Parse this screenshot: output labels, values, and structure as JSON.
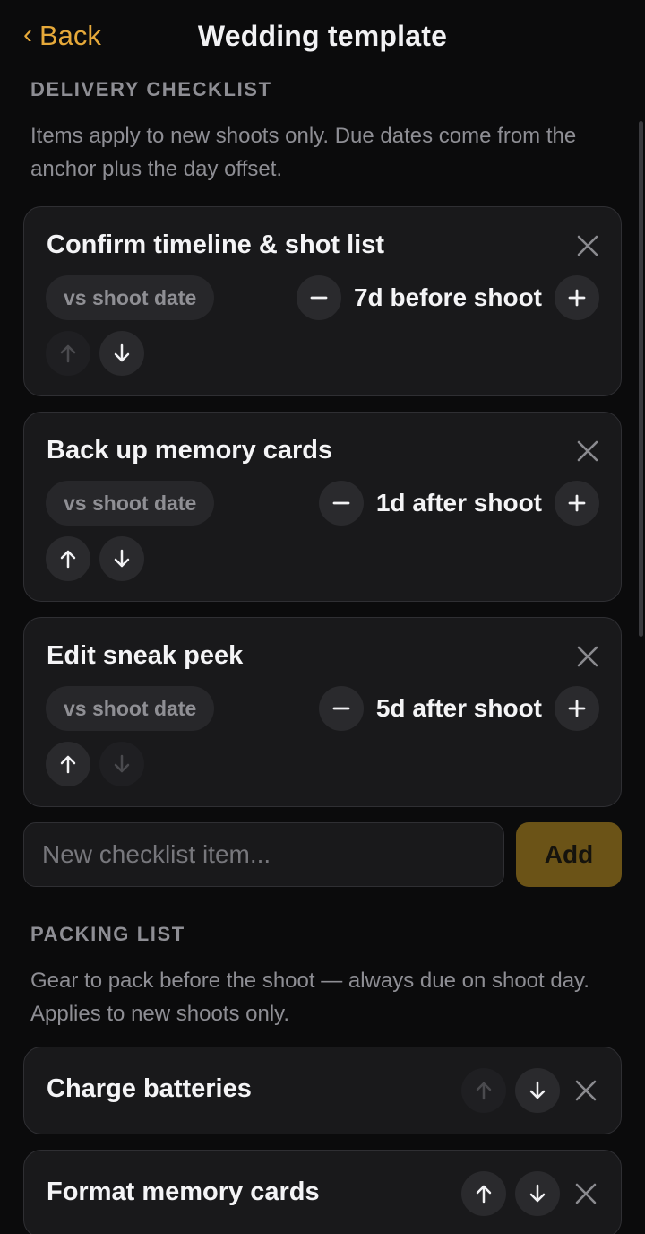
{
  "header": {
    "back_label": "Back",
    "title": "Wedding template"
  },
  "delivery": {
    "section_title": "DELIVERY CHECKLIST",
    "description": "Items apply to new shoots only. Due dates come from the anchor plus the day offset.",
    "items": [
      {
        "title": "Confirm timeline & shot list",
        "anchor": "vs shoot date",
        "offset": "7d before shoot",
        "up_enabled": false,
        "down_enabled": true
      },
      {
        "title": "Back up memory cards",
        "anchor": "vs shoot date",
        "offset": "1d after shoot",
        "up_enabled": true,
        "down_enabled": true
      },
      {
        "title": "Edit sneak peek",
        "anchor": "vs shoot date",
        "offset": "5d after shoot",
        "up_enabled": true,
        "down_enabled": false
      }
    ],
    "new_item_placeholder": "New checklist item...",
    "add_label": "Add"
  },
  "packing": {
    "section_title": "PACKING LIST",
    "description": "Gear to pack before the shoot — always due on shoot day. Applies to new shoots only.",
    "items": [
      {
        "title": "Charge batteries",
        "up_enabled": false,
        "down_enabled": true
      },
      {
        "title": "Format memory cards",
        "up_enabled": true,
        "down_enabled": true
      }
    ]
  },
  "colors": {
    "accent": "#e6a93a",
    "background": "#0b0b0c",
    "card": "#19191b",
    "add_button": "#6b5317"
  },
  "icons": {
    "back": "chevron-left-icon",
    "remove": "close-icon",
    "decrement": "minus-icon",
    "increment": "plus-icon",
    "move_up": "arrow-up-icon",
    "move_down": "arrow-down-icon"
  }
}
